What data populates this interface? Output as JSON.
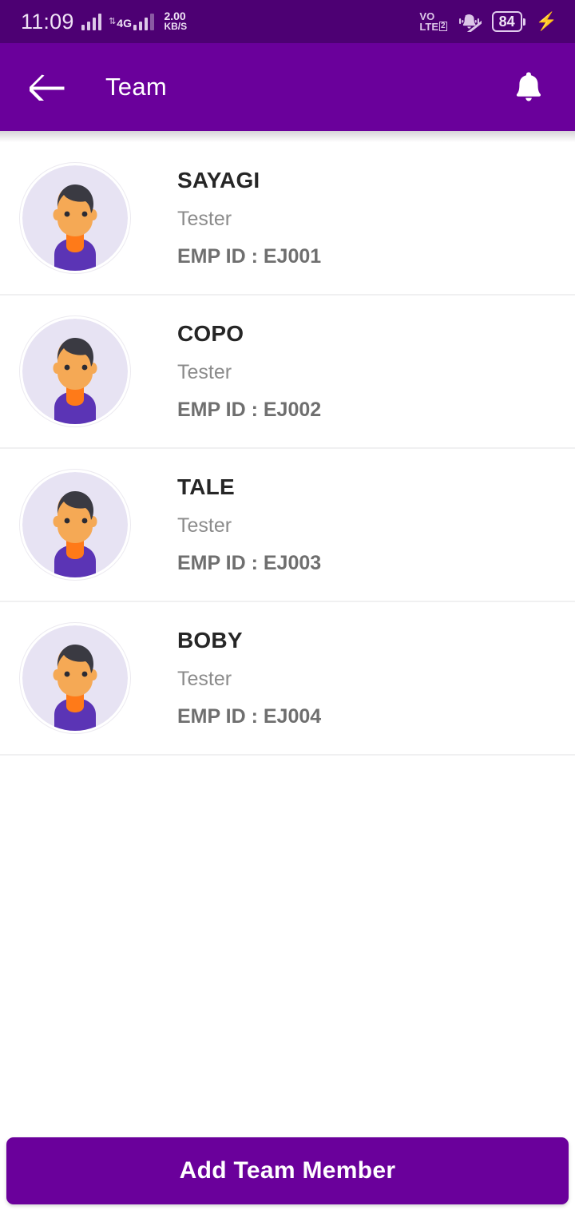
{
  "status_bar": {
    "time": "11:09",
    "network_arrows": "⇅",
    "network_type": "4G",
    "speed_value": "2.00",
    "speed_unit": "KB/S",
    "volte_line1": "VO",
    "volte_line2": "LTE",
    "volte_sim_badge": "2",
    "ringer_icon": "bell-muted-icon",
    "battery_level": "84",
    "charging_icon": "⚡",
    "background_color": "#4D0073"
  },
  "app_bar": {
    "back_icon": "arrow-left-icon",
    "title": "Team",
    "notification_icon": "bell-icon",
    "background_color": "#6A009B"
  },
  "team": {
    "members": [
      {
        "name": "SAYAGI",
        "role": "Tester",
        "emp_id": "EMP ID : EJ001",
        "avatar": "avatar-male-icon"
      },
      {
        "name": "COPO",
        "role": "Tester",
        "emp_id": "EMP ID : EJ002",
        "avatar": "avatar-male-icon"
      },
      {
        "name": "TALE",
        "role": "Tester",
        "emp_id": "EMP ID : EJ003",
        "avatar": "avatar-male-icon"
      },
      {
        "name": "BOBY",
        "role": "Tester",
        "emp_id": "EMP ID : EJ004",
        "avatar": "avatar-male-icon"
      }
    ]
  },
  "bottom_bar": {
    "add_button_label": "Add Team Member",
    "button_color": "#6A009B"
  },
  "avatar_colors": {
    "ring": "#eceaf0",
    "disc": "#e7e3f3",
    "hair": "#3a3a42",
    "skin": "#f5a955",
    "neck": "#ff7a18",
    "shirt": "#5b34b5"
  }
}
